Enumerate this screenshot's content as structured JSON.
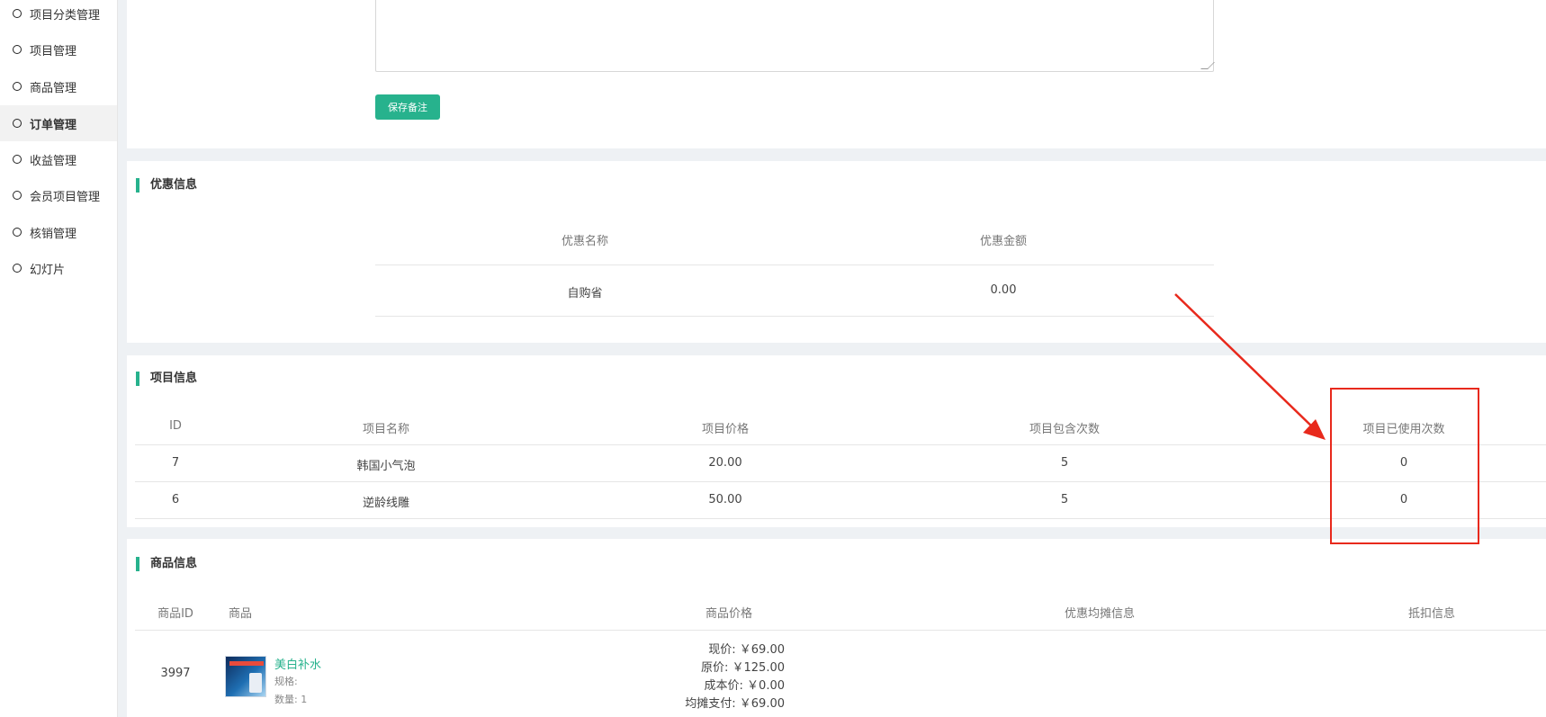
{
  "sidebar": {
    "items": [
      {
        "label": "项目分类管理"
      },
      {
        "label": "项目管理"
      },
      {
        "label": "商品管理"
      },
      {
        "label": "订单管理"
      },
      {
        "label": "收益管理"
      },
      {
        "label": "会员项目管理"
      },
      {
        "label": "核销管理"
      },
      {
        "label": "幻灯片"
      }
    ]
  },
  "remark": {
    "save_label": "保存备注"
  },
  "discount": {
    "title": "优惠信息",
    "headers": [
      "优惠名称",
      "优惠金额"
    ],
    "rows": [
      [
        "自购省",
        "0.00"
      ]
    ]
  },
  "project": {
    "title": "项目信息",
    "headers": [
      "ID",
      "项目名称",
      "项目价格",
      "项目包含次数",
      "项目已使用次数"
    ],
    "rows": [
      [
        "7",
        "韩国小气泡",
        "20.00",
        "5",
        "0"
      ],
      [
        "6",
        "逆龄线雕",
        "50.00",
        "5",
        "0"
      ]
    ]
  },
  "goods": {
    "title": "商品信息",
    "headers": [
      "商品ID",
      "商品",
      "商品价格",
      "优惠均摊信息",
      "抵扣信息"
    ],
    "rows": [
      {
        "id": "3997",
        "name": "美白补水",
        "spec": "规格:",
        "qty": "数量:  1",
        "prices": [
          "现价: ￥69.00",
          "原价: ￥125.00",
          "成本价: ￥0.00",
          "均摊支付: ￥69.00"
        ]
      }
    ]
  },
  "colors": {
    "accent": "#27b28d",
    "annotation": "#e8291c"
  }
}
